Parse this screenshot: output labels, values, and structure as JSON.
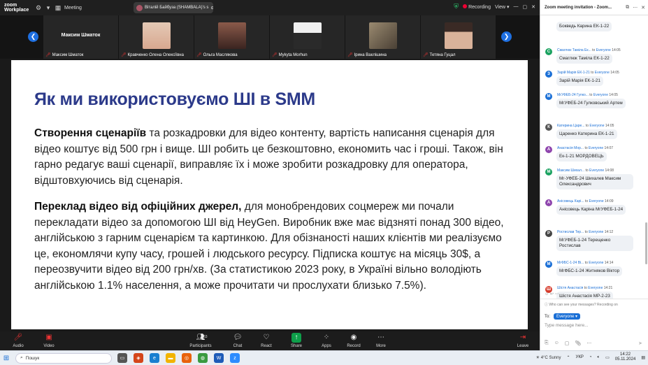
{
  "app": {
    "title_line1": "zoom",
    "title_line2": "Workplace",
    "meeting_label": "Meeting",
    "share_banner": "Віталій Байбуза (SHAMBALA)'s s",
    "recording": "Recording",
    "view": "View"
  },
  "participants": [
    {
      "name": "Максим Шматок",
      "big_name": "Максим Шматок",
      "photo_color": ""
    },
    {
      "name": "Кравченко Олена Олексіївна",
      "big_name": "",
      "photo_color": "#d8a890"
    },
    {
      "name": "Ольга Маслякова",
      "big_name": "",
      "photo_color": "#5b3a30"
    },
    {
      "name": "Mykyta Morhun",
      "big_name": "",
      "photo_color": "#2a2a2a"
    },
    {
      "name": "Ірина Ваклішина",
      "big_name": "",
      "photo_color": "#7a6a55"
    },
    {
      "name": "Тетяна Гуцал",
      "big_name": "",
      "photo_color": "#c99a80"
    }
  ],
  "slide": {
    "title": "Як ми використовуємо ШІ в SMM",
    "p1_bold": "Створення сценаріїв",
    "p1_text": " та розкадровки для відео контенту, вартість написання сценарія для відео коштує від 500 грн і вище. ШІ робить це безкоштовно, економить час і гроші. Також, він гарно редагує ваші сценарії, виправляє їх і може зробити розкадровку для оператора, відштовхуючись від сценарія.",
    "p2_bold": "Переклад відео від офіційних джерел,",
    "p2_text": " для монобрендових соцмереж ми почали перекладати відео за допомогою ШІ від HeyGen. Виробник вже має відзняті понад 300 відео, англійською з гарним сценарієм та картинкою. Для обізнаності наших клієнтів ми реалізуємо це, економлячи купу часу, грошей і людського ресурсу. Підписка коштує на місяць 30$, а переозвучити відео від 200 грн/хв. (За статистикою 2023 року, в Україні вільно володіють англійською 1.1% населення, а може прочитати чи прослухати близько 7.5%)."
  },
  "toolbar": {
    "audio": "Audio",
    "video": "Video",
    "participants": "Participants",
    "participants_count": "63",
    "chat": "Chat",
    "react": "React",
    "share": "Share",
    "apps": "Apps",
    "record": "Record",
    "more": "More",
    "leave": "Leave"
  },
  "chat": {
    "header": "Zoom meeting invitation - Zoom...",
    "messages": [
      {
        "initial": "",
        "color": "#888",
        "sender": "",
        "to": "",
        "time": "",
        "text": "Бокведь Карина ЕК-1-22"
      },
      {
        "initial": "С",
        "color": "#1aa260",
        "sender": "Смаглюк Таміла Ек...",
        "to": "Everyone",
        "time": "14:05",
        "text": "Смаглюк Таміла ЕК-1-22"
      },
      {
        "initial": "З",
        "color": "#1a6fd6",
        "sender": "Зарій Марія ЕК-1-21",
        "to": "Everyone",
        "time": "14:05",
        "text": "Зарій Марія ЕК-1-21"
      },
      {
        "initial": "М",
        "color": "#1a6fd6",
        "sender": "МгУФЕБ-24 Гулко...",
        "to": "Everyone",
        "time": "14:05",
        "text": "МгУФЕБ-24 Гулковський Артем"
      },
      {
        "initial": "К",
        "color": "#555",
        "sender": "Катерина Царе...",
        "to": "Everyone",
        "time": "14:05",
        "text": "Царенко Катерина ЕК-1-21"
      },
      {
        "initial": "А",
        "color": "#8e44ad",
        "sender": "Анастасія Мор...",
        "to": "Everyone",
        "time": "14:07",
        "text": "Ек-1-21 МОРДОВЕЦЬ"
      },
      {
        "initial": "М",
        "color": "#1aa260",
        "sender": "Максим Шихал...",
        "to": "Everyone",
        "time": "14:08",
        "text": "Мг-УФЕБ-24 Шихалев Максим Олександрович"
      },
      {
        "initial": "А",
        "color": "#8e44ad",
        "sender": "Анісовець Карі...",
        "to": "Everyone",
        "time": "14:09",
        "text": "Анісовець Каріна МгУФЕБ-1-24"
      },
      {
        "initial": "Р",
        "color": "#444",
        "sender": "Ростислав Тер...",
        "to": "Everyone",
        "time": "14:12",
        "text": "МгУФЕБ-1-24 Терещенко Ростислав"
      },
      {
        "initial": "М",
        "color": "#1a6fd6",
        "sender": "МгФБС-1-24 Ві...",
        "to": "Everyone",
        "time": "14:14",
        "text": "МгФБС-1-24 Житняков Віктор"
      },
      {
        "initial": "Ш",
        "color": "#d63a2a",
        "sender": "Шістя Анастасія",
        "to": "Everyone",
        "time": "14:21",
        "text": "Шістя Анастасія МР-2-23"
      }
    ],
    "notice": "Who can see your messages? Recording on",
    "to_label": "To:",
    "to_value": "Everyone",
    "placeholder": "Type message here..."
  },
  "taskbar": {
    "search": "Пошук",
    "weather": "4°C Sunny",
    "lang": "УКР",
    "time": "14:22",
    "date": "05.11.2024"
  }
}
